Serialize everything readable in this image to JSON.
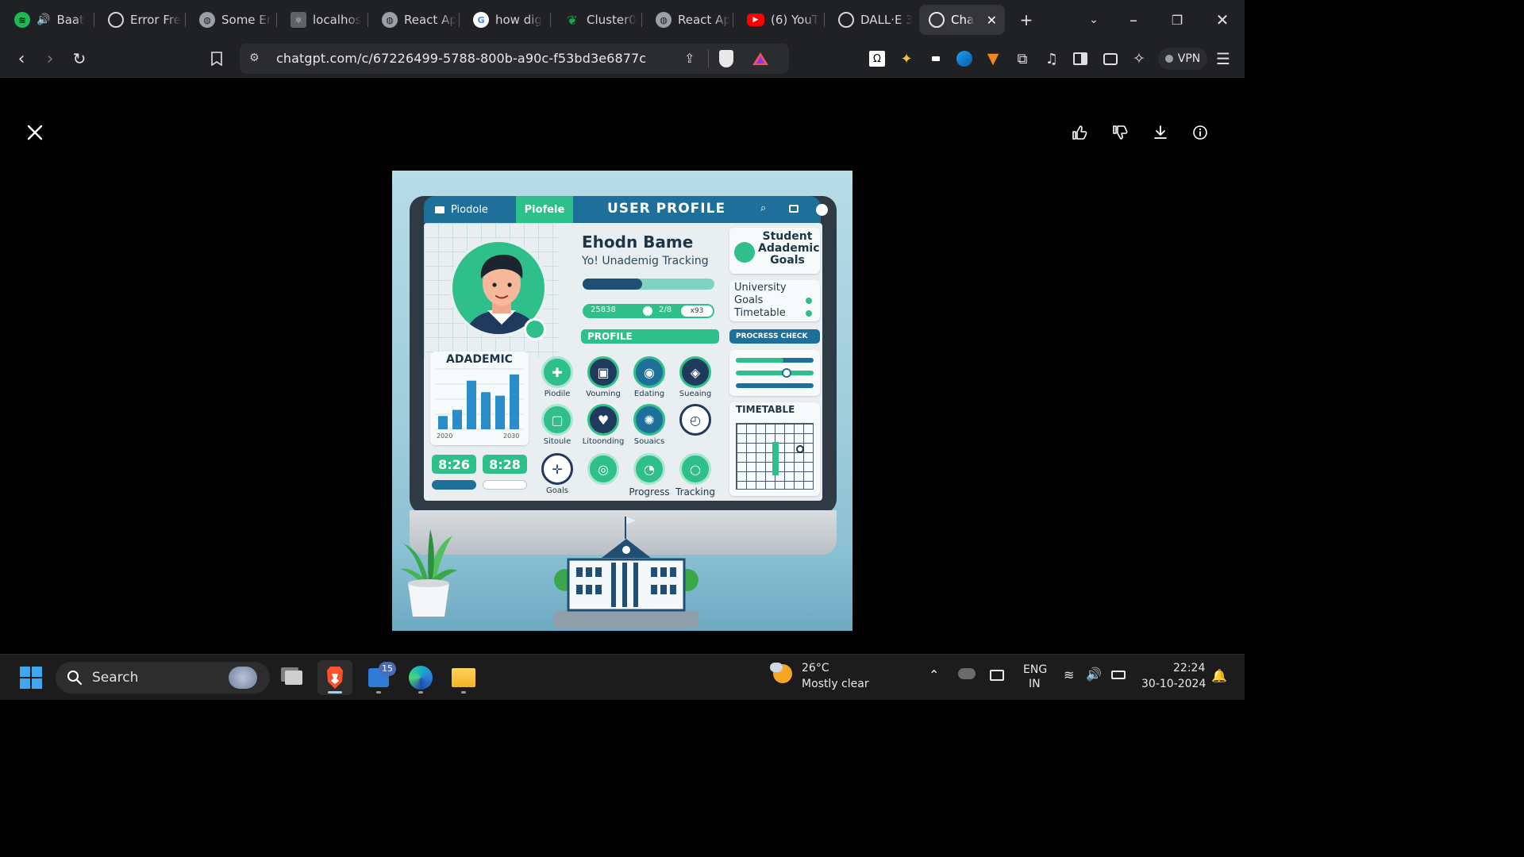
{
  "browser": {
    "tabs": [
      {
        "title": "Baat",
        "icon": "spotify-icon",
        "audio": true
      },
      {
        "title": "Error Fre",
        "icon": "chatgpt-icon"
      },
      {
        "title": "Some Er",
        "icon": "globe-icon"
      },
      {
        "title": "localhos",
        "icon": "react-icon"
      },
      {
        "title": "React Ap",
        "icon": "globe-icon"
      },
      {
        "title": "how dig",
        "icon": "google-icon"
      },
      {
        "title": "Cluster0",
        "icon": "mongodb-icon"
      },
      {
        "title": "React Ap",
        "icon": "globe-icon"
      },
      {
        "title": "(6) YouT",
        "icon": "youtube-icon"
      },
      {
        "title": "DALL·E 3",
        "icon": "chatgpt-icon"
      },
      {
        "title": "Cha",
        "icon": "chatgpt-icon",
        "active": true
      }
    ],
    "new_tab": "+",
    "url": "chatgpt.com/c/67226499-5788-800b-a90c-f53bd3e6877c",
    "vpn_label": "VPN"
  },
  "viewer": {
    "close_icon": "close-icon",
    "actions": [
      "thumbs-up-icon",
      "thumbs-down-icon",
      "download-icon",
      "info-icon"
    ]
  },
  "image": {
    "nav_tabs": [
      "Piodole",
      "Piofele"
    ],
    "title": "USER PROFILE",
    "name": "Ehodn Bame",
    "subtitle": "Yo! Unademig Tracking",
    "progress_pill": "PROFILE",
    "bar_label": "25838",
    "bar_mid": "2/8",
    "bar_right": "x93",
    "goals_card": "Student Adademic Goals",
    "univ_card": [
      "University",
      "Goals",
      "Timetable"
    ],
    "progress_check": "PROCRESS CHECK",
    "academic_title": "ADADEMIC",
    "academic_x_left": "2020",
    "academic_x_right": "2030",
    "clock_1": "8:26",
    "clock_2": "8:28",
    "icons_row1": [
      "Piodile",
      "Vouming",
      "Edating",
      "Sueaing"
    ],
    "icons_row2": [
      "Sitoule",
      "Litoonding",
      "Souaics",
      ""
    ],
    "icons_row3": [
      "Goals",
      "",
      "Progress",
      "Tracking"
    ],
    "timetable_title": "TIMETABLE",
    "academic_chart": {
      "type": "bar",
      "values": [
        15,
        22,
        55,
        42,
        38,
        62
      ]
    }
  },
  "taskbar": {
    "search_placeholder": "Search",
    "badge_count": "15",
    "weather_temp": "26°C",
    "weather_desc": "Mostly clear",
    "lang_1": "ENG",
    "lang_2": "IN",
    "time": "22:24",
    "date": "30-10-2024"
  },
  "colors": {
    "accent_green": "#2fbf8a",
    "accent_blue": "#1f6f9b",
    "dark_navy": "#1d3647"
  }
}
